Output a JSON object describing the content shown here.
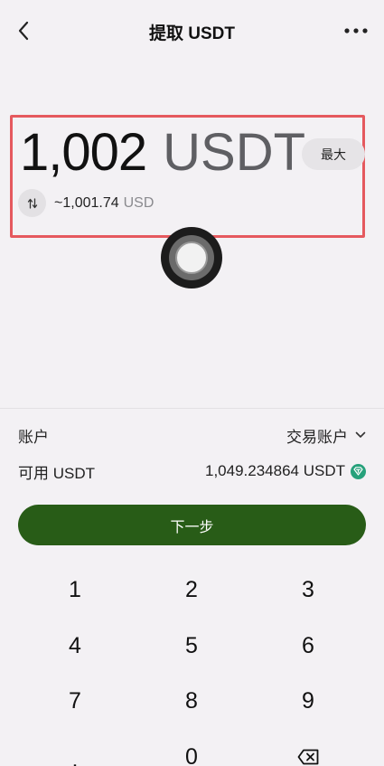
{
  "nav": {
    "title": "提取 USDT",
    "back_icon": "chevron-left-icon",
    "more_icon": "more-horizontal-icon"
  },
  "amount": {
    "value": "1,002",
    "unit": "USDT",
    "max_label": "最大"
  },
  "conversion": {
    "icon": "swap-vertical-icon",
    "approx_value": "~1,001.74",
    "approx_unit": "USD"
  },
  "account": {
    "label": "账户",
    "value": "交易账户"
  },
  "available": {
    "label": "可用 USDT",
    "value": "1,049.234864 USDT",
    "icon": "usdt-token-icon"
  },
  "next_label": "下一步",
  "keypad": {
    "keys": [
      "1",
      "2",
      "3",
      "4",
      "5",
      "6",
      "7",
      "8",
      "9",
      ".",
      "0"
    ],
    "delete_icon": "backspace-icon"
  },
  "colors": {
    "background": "#f3f1f4",
    "primary_button": "#285c17",
    "highlight_border": "#e5595e",
    "usdt": "#26a17b"
  }
}
